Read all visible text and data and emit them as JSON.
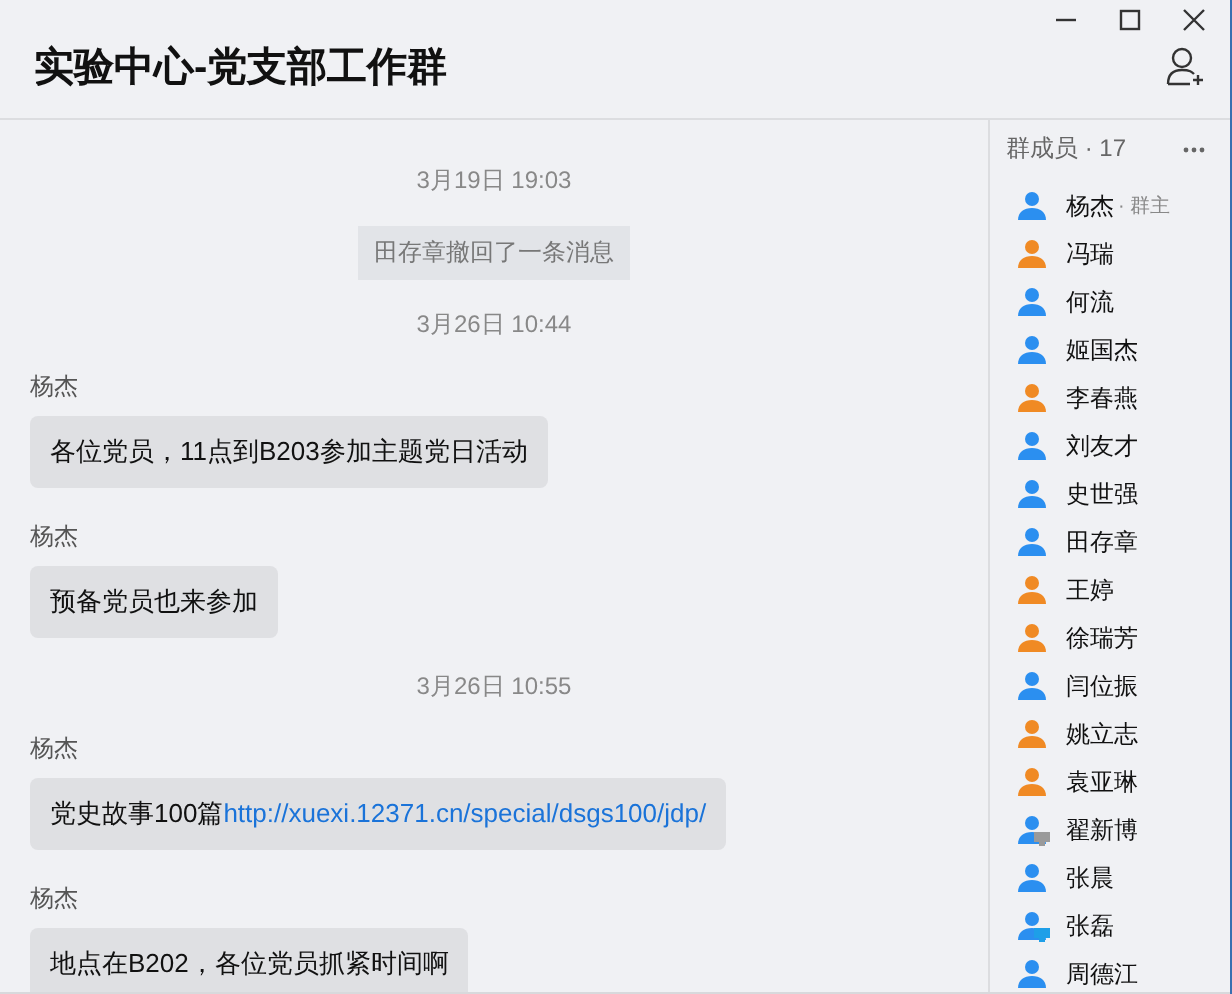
{
  "window": {
    "title": "实验中心-党支部工作群"
  },
  "chat": [
    {
      "kind": "time",
      "text": "3月19日 19:03"
    },
    {
      "kind": "notice",
      "text": "田存章撤回了一条消息"
    },
    {
      "kind": "time",
      "text": "3月26日 10:44"
    },
    {
      "kind": "message",
      "sender": "杨杰",
      "text": "各位党员，11点到B203参加主题党日活动"
    },
    {
      "kind": "message",
      "sender": "杨杰",
      "text": "预备党员也来参加"
    },
    {
      "kind": "time",
      "text": "3月26日 10:55"
    },
    {
      "kind": "message",
      "sender": "杨杰",
      "text": "党史故事100篇",
      "link": "http://xuexi.12371.cn/special/dsgs100/jdp/"
    },
    {
      "kind": "message",
      "sender": "杨杰",
      "text": "地点在B202，各位党员抓紧时间啊"
    }
  ],
  "members": {
    "title": "群成员 · 17",
    "items": [
      {
        "name": "杨杰",
        "role": "· 群主",
        "color": "#2b8ff0",
        "kind": "plain"
      },
      {
        "name": "冯瑞",
        "color": "#f08a24",
        "kind": "plain"
      },
      {
        "name": "何流",
        "color": "#2b8ff0",
        "kind": "plain"
      },
      {
        "name": "姬国杰",
        "color": "#2b8ff0",
        "kind": "plain"
      },
      {
        "name": "李春燕",
        "color": "#f08a24",
        "kind": "plain"
      },
      {
        "name": "刘友才",
        "color": "#2b8ff0",
        "kind": "plain"
      },
      {
        "name": "史世强",
        "color": "#2b8ff0",
        "kind": "plain"
      },
      {
        "name": "田存章",
        "color": "#2b8ff0",
        "kind": "plain"
      },
      {
        "name": "王婷",
        "color": "#f08a24",
        "kind": "plain"
      },
      {
        "name": "徐瑞芳",
        "color": "#f08a24",
        "kind": "plain"
      },
      {
        "name": "闫位振",
        "color": "#2b8ff0",
        "kind": "plain"
      },
      {
        "name": "姚立志",
        "color": "#f08a24",
        "kind": "plain"
      },
      {
        "name": "袁亚琳",
        "color": "#f08a24",
        "kind": "plain"
      },
      {
        "name": "翟新博",
        "color": "#2b8ff0",
        "kind": "pc-offline"
      },
      {
        "name": "张晨",
        "color": "#2b8ff0",
        "kind": "plain"
      },
      {
        "name": "张磊",
        "color": "#2b8ff0",
        "kind": "pc-online"
      },
      {
        "name": "周德江",
        "color": "#2b8ff0",
        "kind": "plain"
      }
    ]
  }
}
